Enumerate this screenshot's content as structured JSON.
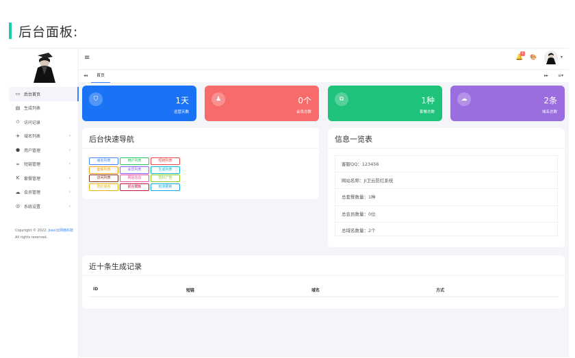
{
  "heading": "后台面板:",
  "sidebar": {
    "items": [
      {
        "label": "后台首页",
        "icon": "▭",
        "icon_name": "dashboard-icon",
        "active": true,
        "chevron": false
      },
      {
        "label": "生成列表",
        "icon": "▤",
        "icon_name": "list-icon",
        "active": false,
        "chevron": false
      },
      {
        "label": "访问记录",
        "icon": "✩",
        "icon_name": "star-icon",
        "active": false,
        "chevron": false
      },
      {
        "label": "域名列表",
        "icon": "✈",
        "icon_name": "send-icon",
        "active": false,
        "chevron": true
      },
      {
        "label": "用户管理",
        "icon": "●",
        "icon_name": "user-icon",
        "active": false,
        "chevron": true
      },
      {
        "label": "短链管理",
        "icon": "∞",
        "icon_name": "link-icon",
        "active": false,
        "chevron": true
      },
      {
        "label": "套餐管理",
        "icon": "K",
        "icon_name": "package-icon",
        "active": false,
        "chevron": true
      },
      {
        "label": "会员管理",
        "icon": "☁",
        "icon_name": "cloud-icon",
        "active": false,
        "chevron": true
      },
      {
        "label": "系统设置",
        "icon": "◎",
        "icon_name": "settings-icon",
        "active": false,
        "chevron": true
      }
    ],
    "chevron": "›",
    "copyright_prefix": "Copyright © 2022.",
    "copyright_link": "Jiwei云网络科技",
    "copyright_suffix": "All rights reserved."
  },
  "topbar": {
    "hamburger": "≡",
    "bell": "🔔",
    "badge": "1",
    "palette": "🎨",
    "caret": "▾"
  },
  "tabs": {
    "prev": "◂◂",
    "home": "首页",
    "next": "▸▸",
    "menu": "≡▾"
  },
  "stats": [
    {
      "value": "1天",
      "label": "运营天数",
      "icon": "⛉",
      "icon_name": "shield-icon",
      "color": "#1a73f5"
    },
    {
      "value": "0个",
      "label": "会员总数",
      "icon": "♟",
      "icon_name": "member-icon",
      "color": "#f76b6b"
    },
    {
      "value": "1种",
      "label": "套餐总数",
      "icon": "⧉",
      "icon_name": "package-icon",
      "color": "#1ec27a"
    },
    {
      "value": "2条",
      "label": "域名总数",
      "icon": "☁",
      "icon_name": "cloud-icon",
      "color": "#9b6ee0"
    }
  ],
  "quick_nav": {
    "title": "后台快速导航",
    "buttons": [
      {
        "label": "域名列表",
        "color": "#3b82f6"
      },
      {
        "label": "用户列表",
        "color": "#22c55e"
      },
      {
        "label": "短链列表",
        "color": "#ef4444"
      },
      {
        "label": "套餐列表",
        "color": "#f59e0b"
      },
      {
        "label": "会员列表",
        "color": "#8b5cf6"
      },
      {
        "label": "生成列表",
        "color": "#06b6d4"
      },
      {
        "label": "访问列表",
        "color": "#7c2d12"
      },
      {
        "label": "网站信息",
        "color": "#ec4899"
      },
      {
        "label": "防红广告",
        "color": "#84cc16"
      },
      {
        "label": "防红域名",
        "color": "#eab308"
      },
      {
        "label": "前台模板",
        "color": "#be123c"
      },
      {
        "label": "检测更新",
        "color": "#0ea5e9"
      }
    ]
  },
  "info": {
    "title": "信息一览表",
    "rows": [
      "客服QQ：123456",
      "网站名称：JI卫云防红系统",
      "总套餐数量：1种",
      "总会员数量：0位",
      "总域名数量：2个"
    ]
  },
  "records": {
    "title": "近十条生成记录",
    "columns": [
      "ID",
      "短链",
      "域名",
      "方式"
    ]
  }
}
